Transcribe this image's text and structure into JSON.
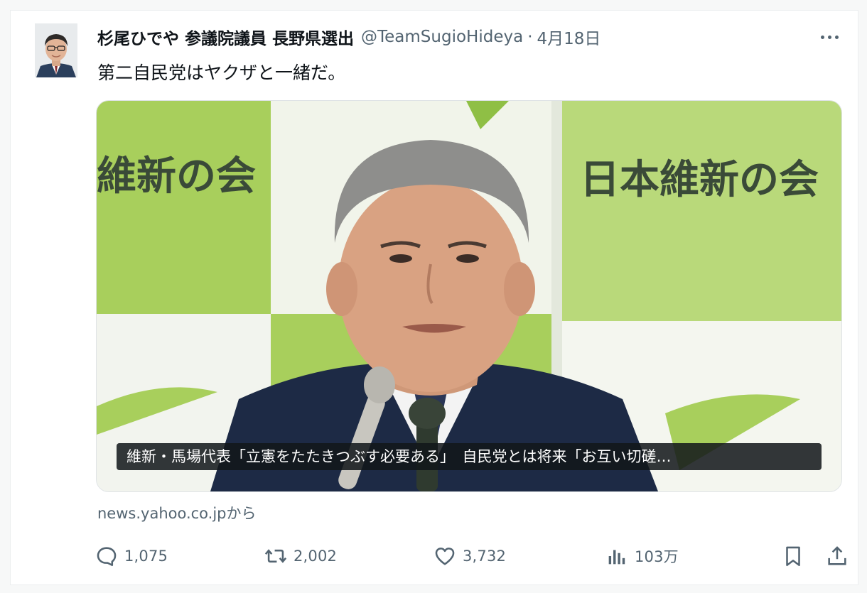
{
  "tweet": {
    "author_name": "杉尾ひでや 参議院議員 長野県選出",
    "author_handle": "@TeamSugioHideya",
    "separator": "·",
    "date": "4月18日",
    "text": "第二自民党はヤクザと一緒だ。"
  },
  "card": {
    "banner_left": "維新の会",
    "banner_right": "日本維新の会",
    "caption": "維新・馬場代表「立憲をたたきつぶす必要ある」　自民党とは将来「お互い切磋…",
    "source": "news.yahoo.co.jpから",
    "colors": {
      "banner_green": "#a8cf5c",
      "banner_light": "#cfe59a",
      "banner_text": "#3a4a38"
    }
  },
  "actions": {
    "reply_count": "1,075",
    "retweet_count": "2,002",
    "like_count": "3,732",
    "views_count": "103万",
    "icons": [
      "reply-icon",
      "retweet-icon",
      "like-icon",
      "views-icon",
      "bookmark-icon",
      "share-icon",
      "more-icon"
    ]
  },
  "colors": {
    "text_primary": "#0f1419",
    "text_secondary": "#536471"
  }
}
